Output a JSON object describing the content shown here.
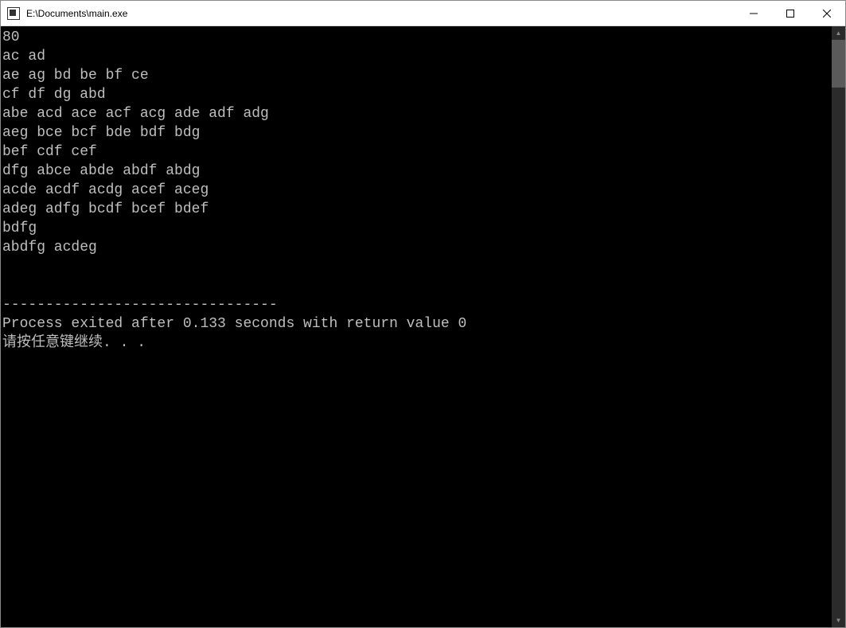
{
  "window": {
    "title": "E:\\Documents\\main.exe"
  },
  "console": {
    "lines": [
      "80",
      "ac ad",
      "ae ag bd be bf ce",
      "cf df dg abd",
      "abe acd ace acf acg ade adf adg",
      "aeg bce bcf bde bdf bdg",
      "bef cdf cef",
      "dfg abce abde abdf abdg",
      "acde acdf acdg acef aceg",
      "adeg adfg bcdf bcef bdef",
      "bdfg",
      "abdfg acdeg",
      "",
      "",
      "--------------------------------",
      "Process exited after 0.133 seconds with return value 0",
      "请按任意键继续. . ."
    ]
  }
}
